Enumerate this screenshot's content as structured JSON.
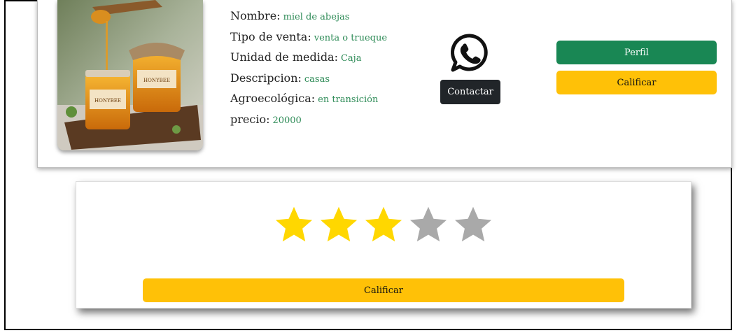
{
  "product": {
    "fields": [
      {
        "label": "Nombre:",
        "value": "miel de abejas"
      },
      {
        "label": "Tipo de venta:",
        "value": "venta o trueque"
      },
      {
        "label": "Unidad de medida:",
        "value": "Caja"
      },
      {
        "label": "Descripcion:",
        "value": "casas"
      },
      {
        "label": "Agroecológica:",
        "value": "en transición"
      },
      {
        "label": "precio:",
        "value": "20000"
      }
    ],
    "image_labels": {
      "left_jar": "HONYBEE",
      "right_jar": "HONYBEE"
    }
  },
  "actions": {
    "contact_label": "Contactar",
    "profile_label": "Perfil",
    "rate_label": "Calificar"
  },
  "rating": {
    "max": 5,
    "value": 3,
    "submit_label": "Calificar"
  },
  "colors": {
    "field_value": "#2e8b57",
    "perfil_button": "#198754",
    "calificar_button": "#ffc107",
    "contact_button": "#212529",
    "star_active": "#ffd700",
    "star_inactive": "#a9a9a9"
  },
  "icons": {
    "contact": "whatsapp-icon",
    "rating": "star-icon"
  }
}
